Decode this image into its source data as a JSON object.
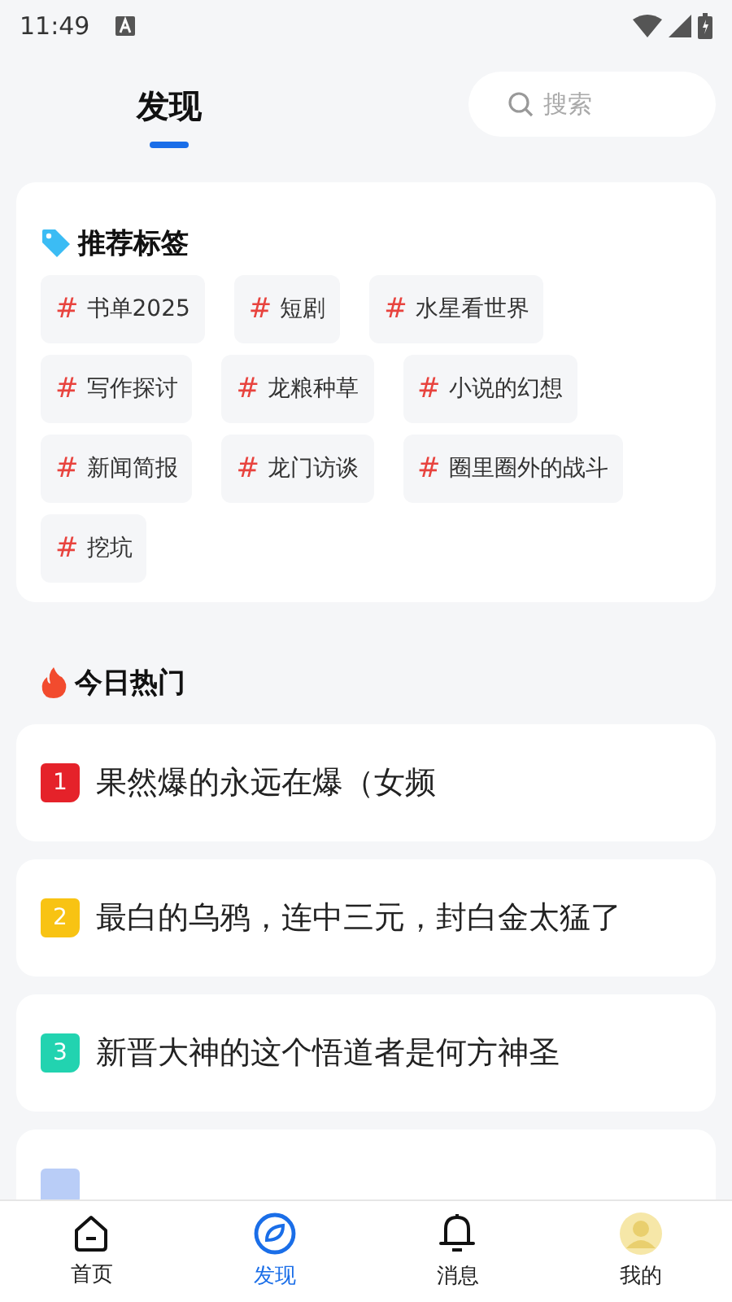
{
  "status_bar": {
    "time": "11:49"
  },
  "header": {
    "tabs": [
      {
        "label": "发现",
        "selected": true
      }
    ],
    "search": {
      "placeholder": "搜索"
    }
  },
  "recommended_tags": {
    "title": "推荐标签",
    "tags": [
      {
        "mark": "#",
        "label": "书单2025"
      },
      {
        "mark": "#",
        "label": "短剧"
      },
      {
        "mark": "#",
        "label": "水星看世界"
      },
      {
        "mark": "#",
        "label": "写作探讨"
      },
      {
        "mark": "#",
        "label": "龙粮种草"
      },
      {
        "mark": "#",
        "label": "小说的幻想"
      },
      {
        "mark": "#",
        "label": "新闻简报"
      },
      {
        "mark": "#",
        "label": "龙门访谈"
      },
      {
        "mark": "#",
        "label": "圈里圈外的战斗"
      },
      {
        "mark": "#",
        "label": "挖坑"
      }
    ]
  },
  "hot_today": {
    "title": "今日热门",
    "items": [
      {
        "rank": "1",
        "color": "#e5222a",
        "title": "果然爆的永远在爆（女频"
      },
      {
        "rank": "2",
        "color": "#f8c313",
        "title": "最白的乌鸦，连中三元，封白金太猛了"
      },
      {
        "rank": "3",
        "color": "#22d3b0",
        "title": "新晋大神的这个悟道者是何方神圣"
      },
      {
        "color": "#b9cdf7"
      }
    ]
  },
  "bottom_nav": [
    {
      "kind": "home",
      "label": "首页",
      "selected": false
    },
    {
      "kind": "compass",
      "label": "发现",
      "selected": true
    },
    {
      "kind": "bell",
      "label": "消息",
      "selected": false
    },
    {
      "kind": "avatar",
      "label": "我的",
      "selected": false
    }
  ]
}
